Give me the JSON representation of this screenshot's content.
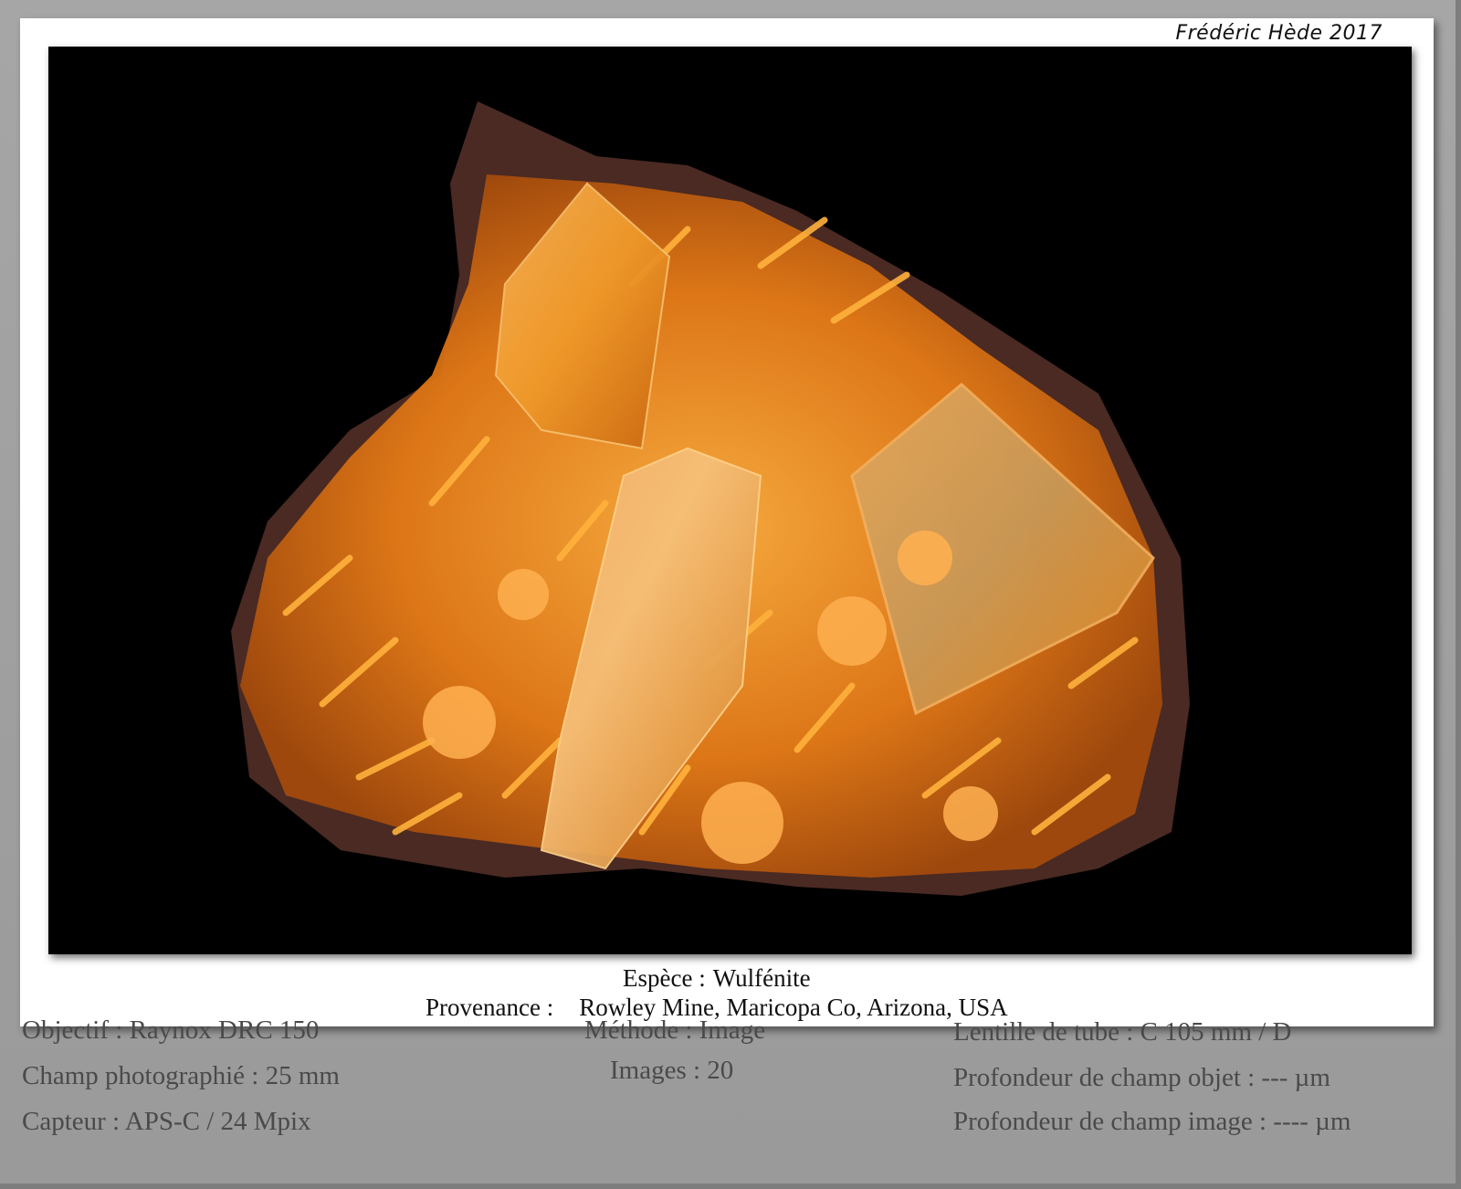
{
  "credit": "Frédéric Hède 2017",
  "photo": {
    "subject": "mineral-specimen-photo"
  },
  "caption": {
    "species_label": "Espèce :",
    "species_value": "Wulfénite",
    "provenance_label": "Provenance :",
    "provenance_value": "Rowley Mine, Maricopa Co, Arizona, USA"
  },
  "info": {
    "objectif": "Objectif : Raynox DRC 150",
    "champ": "Champ photographié : 25 mm",
    "capteur": "Capteur : APS-C / 24 Mpix",
    "methode": "Méthode : Image",
    "images": "Images : 20",
    "lentille": "Lentille de tube : C 105 mm / D",
    "prof_objet": "Profondeur de champ objet : --- µm",
    "prof_image": "Profondeur de champ image : ---- µm"
  },
  "colors": {
    "background": "#9b9b9b",
    "panel": "#ffffff",
    "photo_bg": "#000000",
    "crystal_orange": "#f08a1a",
    "crystal_light": "#ffb84a",
    "matrix": "#4a2a22"
  }
}
